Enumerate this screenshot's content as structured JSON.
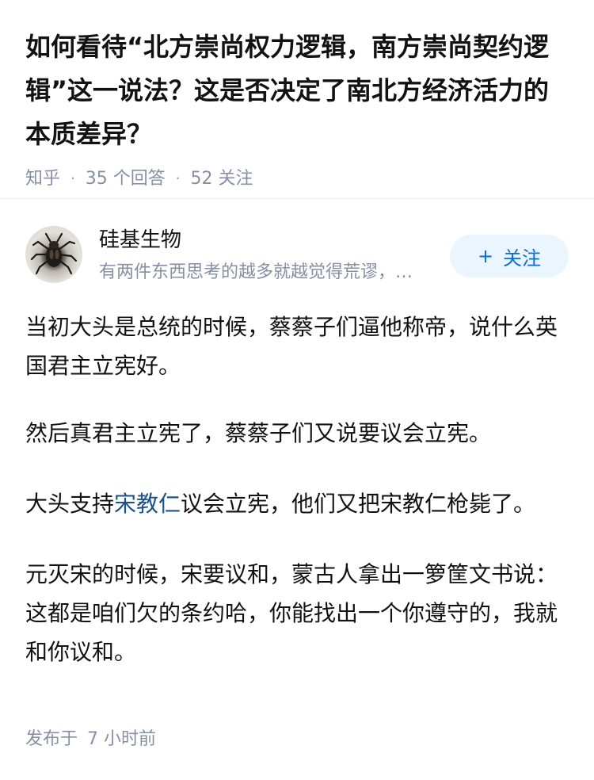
{
  "question": {
    "title": "如何看待“北方崇尚权力逻辑，南方崇尚契约逻辑”这一说法？这是否决定了南北方经济活力的本质差异？",
    "source": "知乎",
    "separator": "·",
    "answer_count": "35",
    "answer_count_label": "个回答",
    "follow_count": "52",
    "follow_count_label": "关注"
  },
  "author": {
    "name": "硅基生物",
    "bio": "有两件东西思考的越多就越觉得荒谬，那就是",
    "avatar_icon": "beetle-avatar-image",
    "follow_button": {
      "plus": "+",
      "label": "关注"
    }
  },
  "answer": {
    "p1": "当初大头是总统的时候，蔡蔡子们逼他称帝，说什么英国君主立宪好。",
    "p2": "然后真君主立宪了，蔡蔡子们又说要议会立宪。",
    "p3_before": "大头支持",
    "p3_link": "宋教仁",
    "p3_after": "议会立宪，他们又把宋教仁枪毙了。",
    "p4": "元灭宋的时候，宋要议和，蒙古人拿出一箩筐文书说：这都是咱们欠的条约哈，你能找出一个你遵守的，我就和你议和。"
  },
  "footer": {
    "publish_label": "发布于",
    "publish_time": "7 小时前"
  },
  "colors": {
    "text": "#121212",
    "meta": "#8590a6",
    "link": "#175199",
    "follow_bg": "#ebf5ff",
    "follow_text": "#056de8"
  }
}
